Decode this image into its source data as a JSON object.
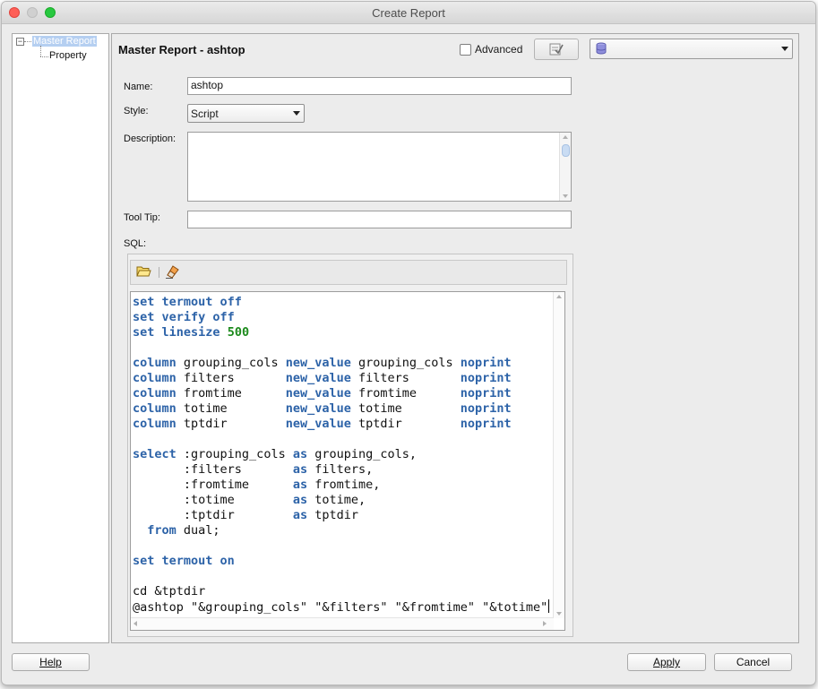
{
  "window": {
    "title": "Create Report"
  },
  "tree": {
    "root_label": "Master Report",
    "child_label": "Property"
  },
  "header": {
    "title": "Master Report - ashtop",
    "advanced_label": "Advanced",
    "advanced_checked": false
  },
  "form": {
    "name_label": "Name:",
    "name_value": "ashtop",
    "style_label": "Style:",
    "style_value": "Script",
    "description_label": "Description:",
    "description_value": "",
    "tooltip_label": "Tool Tip:",
    "tooltip_value": "",
    "sql_label": "SQL:"
  },
  "footer": {
    "help_label": "Help",
    "apply_label": "Apply",
    "cancel_label": "Cancel"
  },
  "colors": {
    "keyword": "#2d63a8",
    "number": "#1c8a1c",
    "selection": "#b5cff1"
  }
}
